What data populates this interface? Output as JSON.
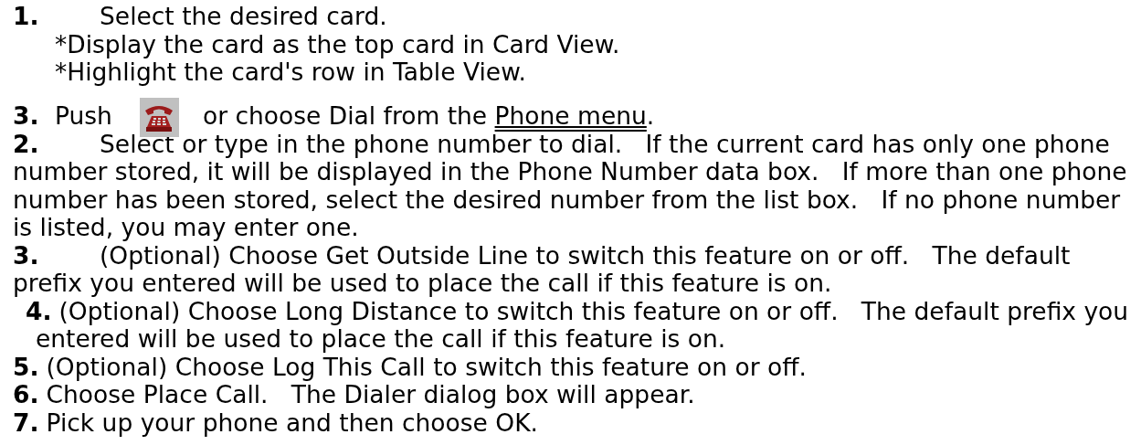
{
  "steps": [
    {
      "kind": "tabbed",
      "number": "1.",
      "text": "Select the desired card.",
      "sub_items": [
        "*Display the card as the top card in Card View.",
        "*Highlight the card's row in Table View."
      ]
    },
    {
      "kind": "icon",
      "number": "3.",
      "before": "Push",
      "after": "or choose Dial from the",
      "link": "Phone menu",
      "end": "."
    },
    {
      "kind": "tabbed",
      "number": "2.",
      "text": "Select or type in the phone number to dial.   If the current card has only one phone number stored, it will be displayed in the Phone Number data box.   If more than one phone number has been stored, select the desired number from the list box.   If no phone number is listed, you may enter one."
    },
    {
      "kind": "tabbed",
      "number": "3.",
      "text": "(Optional) Choose Get Outside Line to switch this feature on or off.   The default prefix you entered will be used to place the call if this feature is on."
    },
    {
      "kind": "hanging",
      "number": "4.",
      "text": "(Optional) Choose Long Distance to switch this feature on or off.   The default prefix you entered will be used to place the call if this feature is on."
    },
    {
      "kind": "plain",
      "number": "5.",
      "text": "(Optional) Choose Log This Call to switch this feature on or off."
    },
    {
      "kind": "plain",
      "number": "6.",
      "text": "Choose Place Call.   The Dialer dialog box will appear."
    },
    {
      "kind": "plain",
      "number": "7.",
      "text": "Pick up your phone and then choose OK."
    }
  ]
}
